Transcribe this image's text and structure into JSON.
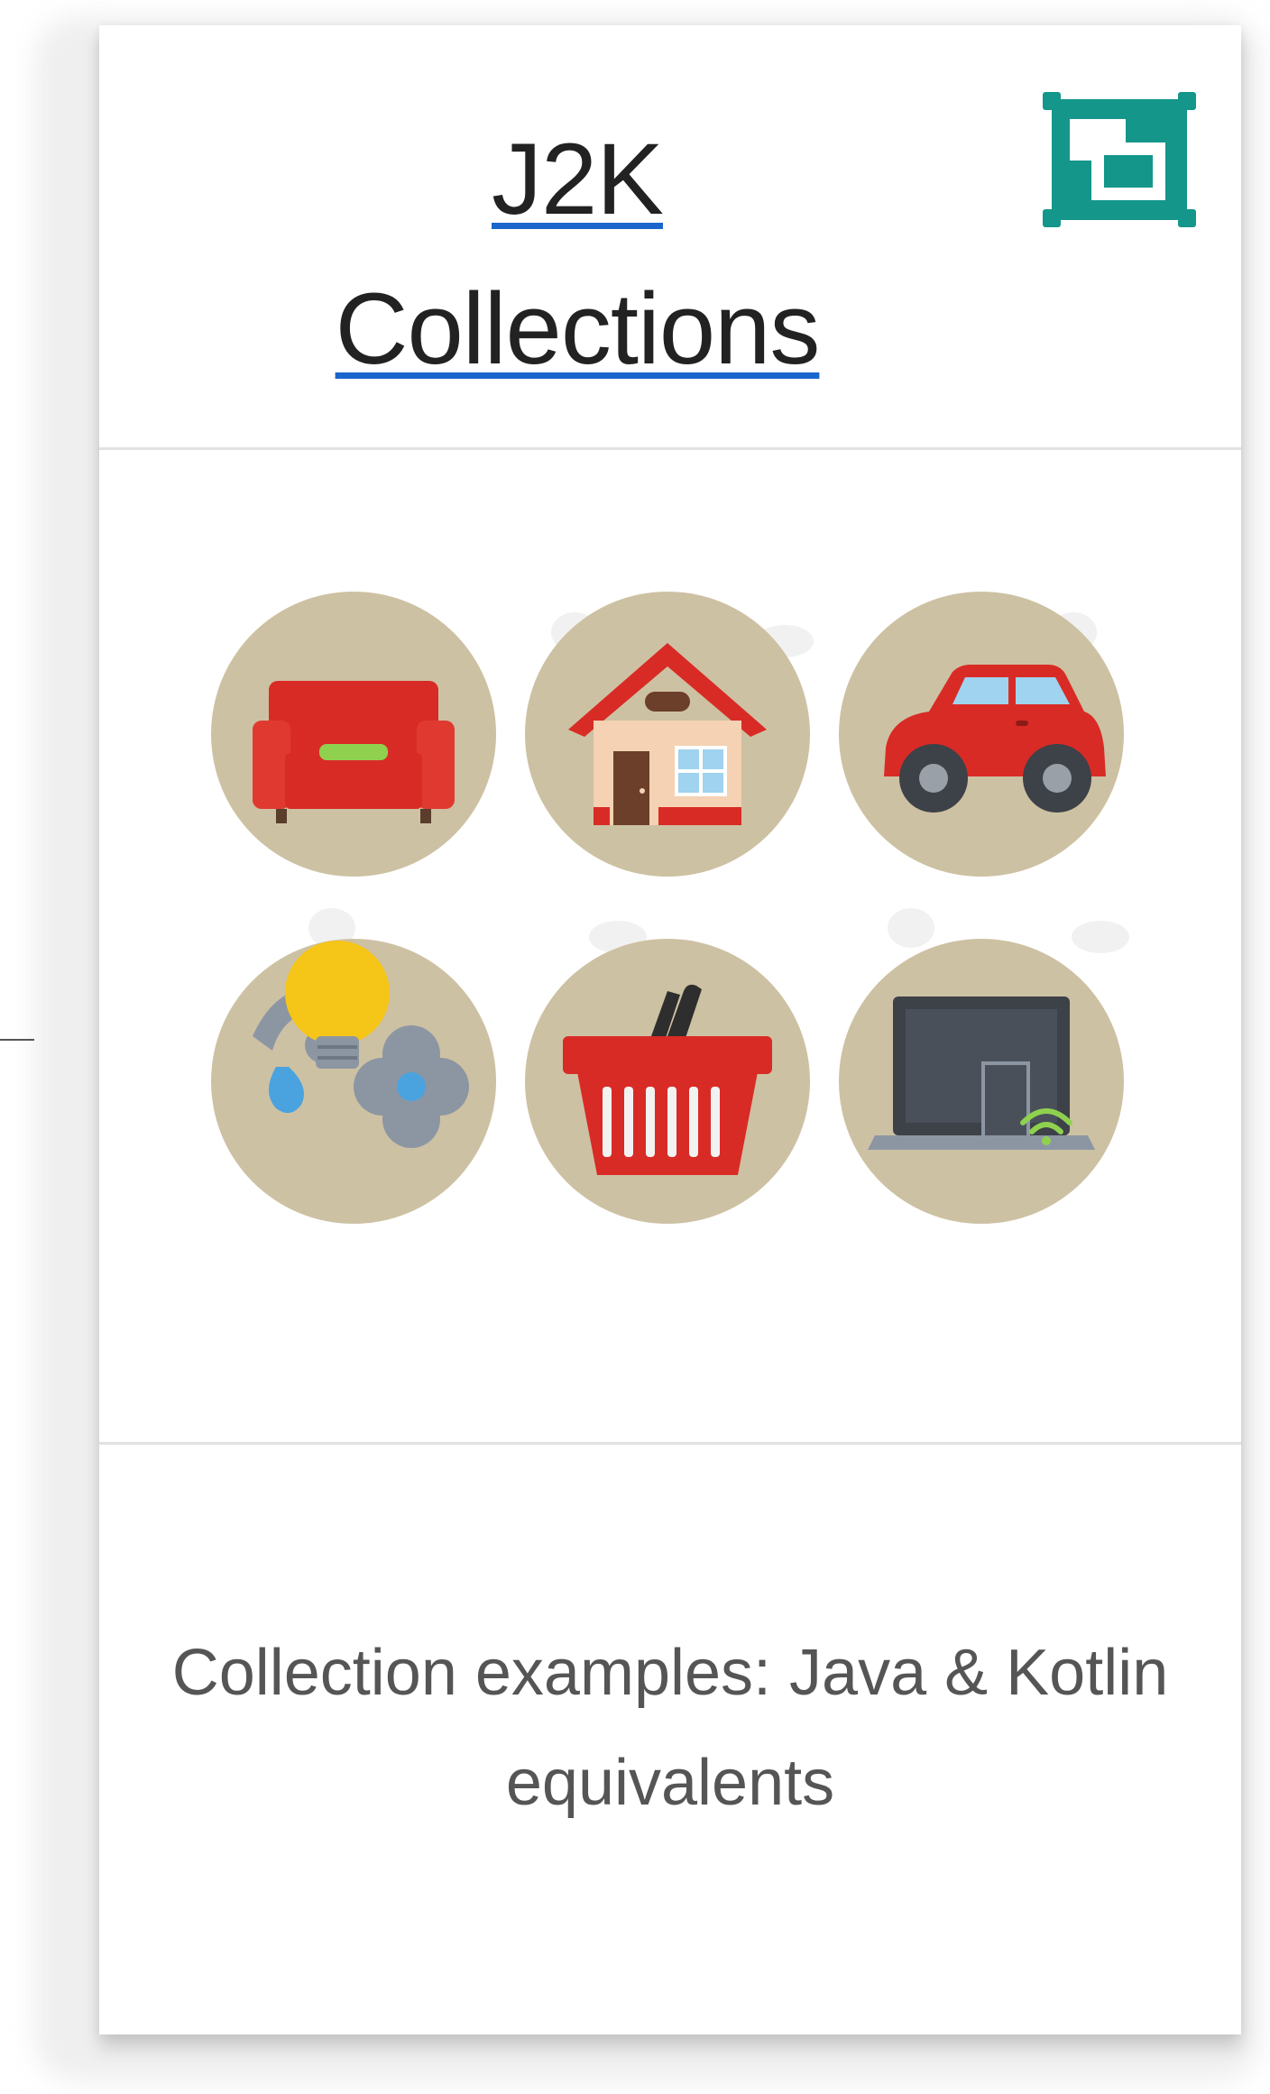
{
  "card": {
    "title_line1": "J2K",
    "title_line2": "Collections",
    "description": "Collection examples: Java & Kotlin equivalents"
  },
  "icons": {
    "expand_icon": "expand-window-icon",
    "items": [
      "sofa-icon",
      "house-icon",
      "car-icon",
      "utilities-icon",
      "shopping-basket-icon",
      "laptop-wifi-icon"
    ]
  },
  "colors": {
    "link_underline": "#1a66cc",
    "expand_icon": "#14968a",
    "circle_bg": "#cdc1a3",
    "accent_red": "#d92b26"
  }
}
